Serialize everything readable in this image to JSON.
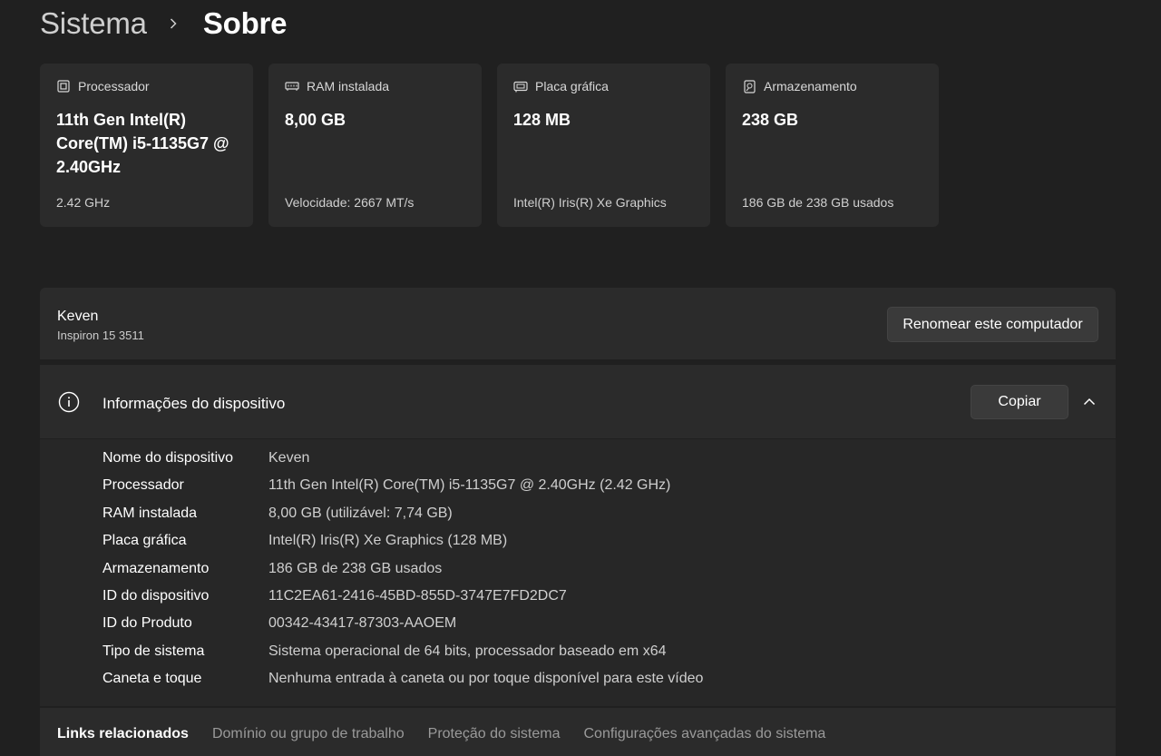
{
  "breadcrumb": {
    "parent": "Sistema",
    "current": "Sobre"
  },
  "cards": [
    {
      "icon": "processor-chip-icon",
      "title": "Processador",
      "value": "11th Gen Intel(R) Core(TM) i5-1135G7 @ 2.40GHz",
      "sub": "2.42 GHz"
    },
    {
      "icon": "ram-memory-icon",
      "title": "RAM instalada",
      "value": "8,00 GB",
      "sub": "Velocidade: 2667 MT/s"
    },
    {
      "icon": "graphics-card-icon",
      "title": "Placa gráfica",
      "value": "128 MB",
      "sub": "Intel(R) Iris(R) Xe Graphics"
    },
    {
      "icon": "storage-drive-icon",
      "title": "Armazenamento",
      "value": "238 GB",
      "sub": "186 GB de 238 GB usados"
    }
  ],
  "computer": {
    "name": "Keven",
    "model": "Inspiron 15 3511",
    "rename_label": "Renomear este computador"
  },
  "device_info": {
    "title": "Informações do dispositivo",
    "copy_label": "Copiar",
    "rows": [
      {
        "label": "Nome do dispositivo",
        "value": "Keven"
      },
      {
        "label": "Processador",
        "value": "11th Gen Intel(R) Core(TM) i5-1135G7 @ 2.40GHz (2.42 GHz)"
      },
      {
        "label": "RAM instalada",
        "value": "8,00 GB (utilizável: 7,74 GB)"
      },
      {
        "label": "Placa gráfica",
        "value": "Intel(R) Iris(R) Xe Graphics (128 MB)"
      },
      {
        "label": "Armazenamento",
        "value": "186 GB de 238 GB usados"
      },
      {
        "label": "ID do dispositivo",
        "value": "11C2EA61-2416-45BD-855D-3747E7FD2DC7"
      },
      {
        "label": "ID do Produto",
        "value": "00342-43417-87303-AAOEM"
      },
      {
        "label": "Tipo de sistema",
        "value": "Sistema operacional de 64 bits, processador baseado em x64"
      },
      {
        "label": "Caneta e toque",
        "value": "Nenhuma entrada à caneta ou por toque disponível para este vídeo"
      }
    ]
  },
  "related_links": {
    "title": "Links relacionados",
    "items": [
      "Domínio ou grupo de trabalho",
      "Proteção do sistema",
      "Configurações avançadas do sistema"
    ]
  }
}
